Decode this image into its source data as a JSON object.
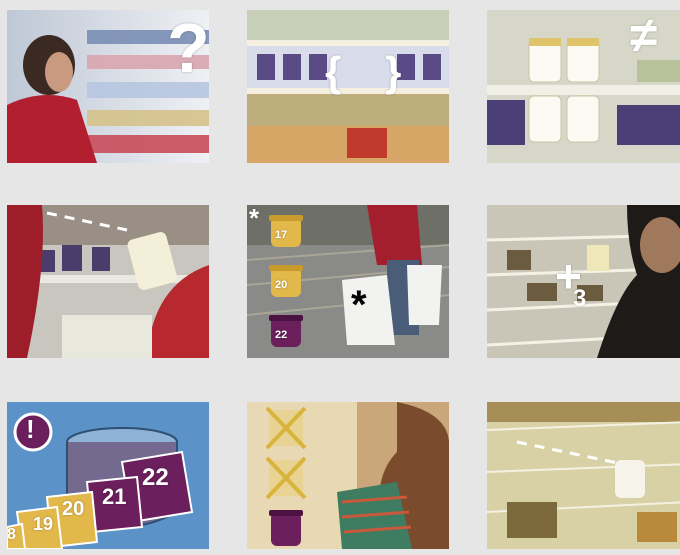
{
  "tiles": [
    {
      "id": "confused-at-shelf",
      "overlay": "?"
    },
    {
      "id": "shelf-group",
      "overlay_left": "{",
      "overlay_right": "}"
    },
    {
      "id": "not-equal-jars",
      "overlay": "≠"
    },
    {
      "id": "picking-jar"
    },
    {
      "id": "expiry-dates",
      "asterisk": "*",
      "dates": [
        "17",
        "20",
        "22"
      ],
      "bag_asterisk": "*"
    },
    {
      "id": "fridge-plus-three",
      "plus": "+",
      "num": "3"
    },
    {
      "id": "alert-calendar",
      "alert": "!",
      "calendar": [
        "19",
        "20",
        "21",
        "22"
      ],
      "edge": "8"
    },
    {
      "id": "crossed-jars"
    },
    {
      "id": "fridge-shelf"
    }
  ],
  "colors": {
    "background": "#e6e6e6",
    "jar_yellow": "#e2b84b",
    "jar_purple": "#6b1f5c",
    "calendar_blue": "#5b93c8"
  }
}
